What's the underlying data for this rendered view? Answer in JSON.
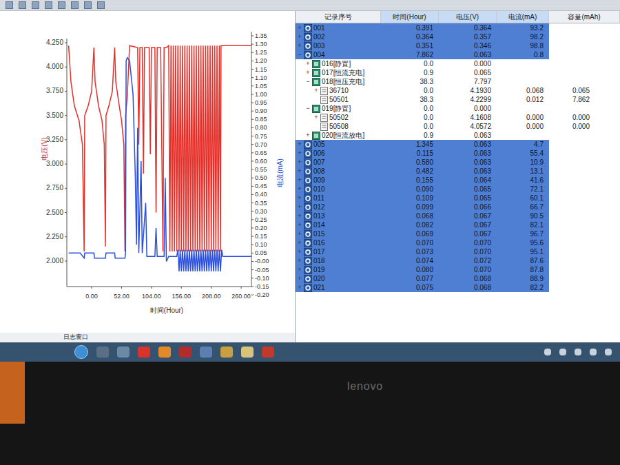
{
  "chart": {
    "y_left_label": "电压(V)",
    "y_right_label": "电流(mA)",
    "x_label": "时间(Hour)",
    "y_left_ticks": [
      "4.250",
      "4.000",
      "3.750",
      "3.500",
      "3.250",
      "3.000",
      "2.750",
      "2.500",
      "2.250",
      "2.000"
    ],
    "y_right_ticks": [
      "1.35",
      "1.30",
      "1.25",
      "1.20",
      "1.15",
      "1.10",
      "1.05",
      "1.00",
      "0.95",
      "0.90",
      "0.85",
      "0.80",
      "0.75",
      "0.70",
      "0.65",
      "0.60",
      "0.55",
      "0.50",
      "0.45",
      "0.40",
      "0.35",
      "0.30",
      "0.25",
      "0.20",
      "0.15",
      "0.10",
      "0.05",
      "-0.00",
      "-0.05",
      "-0.10",
      "-0.15",
      "-0.20"
    ],
    "x_ticks": [
      "0.00",
      "52.00",
      "104.00",
      "156.00",
      "208.00",
      "260.00"
    ],
    "series": [
      {
        "axis": "left",
        "color": "#e8302a",
        "points": [
          [
            -40,
            4.22
          ],
          [
            -36,
            3.85
          ],
          [
            -30,
            3.6
          ],
          [
            -22,
            3.45
          ],
          [
            -16,
            3.2
          ],
          [
            -13,
            2.1
          ],
          [
            -12,
            3.5
          ],
          [
            -6,
            3.6
          ],
          [
            0,
            3.75
          ],
          [
            4,
            4.2
          ],
          [
            6,
            3.85
          ],
          [
            12,
            3.6
          ],
          [
            18,
            3.45
          ],
          [
            22,
            3.2
          ],
          [
            24,
            2.15
          ],
          [
            25,
            3.5
          ],
          [
            30,
            3.6
          ],
          [
            36,
            3.75
          ],
          [
            40,
            4.2
          ],
          [
            42,
            3.85
          ],
          [
            48,
            3.6
          ],
          [
            52,
            3.45
          ],
          [
            56,
            3.2
          ],
          [
            58,
            2.1
          ],
          [
            59,
            3.5
          ],
          [
            62,
            3.7
          ],
          [
            66,
            4.22
          ],
          [
            80,
            4.2
          ],
          [
            82,
            3.2
          ],
          [
            84,
            4.2
          ],
          [
            88,
            4.2
          ],
          [
            90,
            2.9
          ],
          [
            92,
            4.2
          ],
          [
            100,
            4.2
          ],
          [
            102,
            3.1
          ],
          [
            104,
            4.2
          ],
          [
            110,
            4.2
          ],
          [
            112,
            2.5
          ],
          [
            114,
            4.2
          ],
          [
            120,
            4.2
          ],
          [
            124,
            2.1
          ],
          [
            126,
            4.2
          ],
          [
            130,
            4.2
          ],
          [
            134,
            4.22
          ],
          [
            136,
            2.1
          ],
          [
            138,
            4.22
          ],
          [
            140,
            2.1
          ],
          [
            142,
            4.22
          ],
          [
            144,
            2.1
          ],
          [
            146,
            4.22
          ],
          [
            148,
            2.1
          ],
          [
            150,
            4.22
          ],
          [
            152,
            2.1
          ],
          [
            154,
            4.22
          ],
          [
            156,
            2.1
          ],
          [
            158,
            4.22
          ],
          [
            160,
            2.1
          ],
          [
            162,
            4.22
          ],
          [
            164,
            2.1
          ],
          [
            166,
            4.22
          ],
          [
            168,
            2.1
          ],
          [
            170,
            4.22
          ],
          [
            172,
            2.1
          ],
          [
            174,
            4.22
          ],
          [
            176,
            2.1
          ],
          [
            178,
            4.22
          ],
          [
            180,
            2.1
          ],
          [
            182,
            4.22
          ],
          [
            184,
            2.1
          ],
          [
            186,
            4.22
          ],
          [
            188,
            2.1
          ],
          [
            190,
            4.22
          ],
          [
            192,
            2.1
          ],
          [
            194,
            4.22
          ],
          [
            196,
            2.1
          ],
          [
            198,
            4.22
          ],
          [
            200,
            2.1
          ],
          [
            202,
            4.22
          ],
          [
            204,
            2.1
          ],
          [
            206,
            4.22
          ],
          [
            208,
            2.1
          ],
          [
            210,
            4.22
          ],
          [
            212,
            2.1
          ],
          [
            214,
            4.22
          ],
          [
            216,
            2.1
          ],
          [
            218,
            4.22
          ],
          [
            220,
            2.1
          ],
          [
            222,
            4.22
          ],
          [
            224,
            2.1
          ],
          [
            225,
            4.22
          ],
          [
            278,
            4.22
          ]
        ]
      },
      {
        "axis": "right",
        "color": "#2a4fe0",
        "points": [
          [
            -40,
            0.05
          ],
          [
            -20,
            0.05
          ],
          [
            -13,
            0.02
          ],
          [
            -12,
            0.05
          ],
          [
            4,
            0.05
          ],
          [
            5,
            0.02
          ],
          [
            24,
            0.02
          ],
          [
            25,
            0.05
          ],
          [
            40,
            0.05
          ],
          [
            41,
            0.02
          ],
          [
            58,
            0.02
          ],
          [
            59,
            0.05
          ],
          [
            60,
            1.2
          ],
          [
            62,
            1.22
          ],
          [
            66,
            1.2
          ],
          [
            72,
            1.0
          ],
          [
            76,
            0.5
          ],
          [
            78,
            0.1
          ],
          [
            80,
            0.8
          ],
          [
            82,
            0.05
          ],
          [
            86,
            0.6
          ],
          [
            88,
            0.05
          ],
          [
            94,
            0.35
          ],
          [
            96,
            0.03
          ],
          [
            110,
            0.03
          ],
          [
            112,
            0.2
          ],
          [
            114,
            0.03
          ],
          [
            126,
            0.03
          ],
          [
            128,
            0.5
          ],
          [
            130,
            0.0
          ],
          [
            134,
            0.03
          ],
          [
            148,
            0.03
          ],
          [
            150,
            0.07
          ],
          [
            152,
            -0.06
          ],
          [
            154,
            0.07
          ],
          [
            156,
            -0.06
          ],
          [
            158,
            0.07
          ],
          [
            160,
            -0.06
          ],
          [
            162,
            0.07
          ],
          [
            164,
            -0.06
          ],
          [
            166,
            0.07
          ],
          [
            168,
            -0.06
          ],
          [
            170,
            0.07
          ],
          [
            172,
            -0.06
          ],
          [
            174,
            0.07
          ],
          [
            176,
            -0.06
          ],
          [
            178,
            0.07
          ],
          [
            180,
            -0.06
          ],
          [
            182,
            0.07
          ],
          [
            184,
            -0.06
          ],
          [
            186,
            0.07
          ],
          [
            188,
            -0.06
          ],
          [
            190,
            0.07
          ],
          [
            192,
            -0.06
          ],
          [
            194,
            0.07
          ],
          [
            196,
            -0.06
          ],
          [
            198,
            0.07
          ],
          [
            200,
            -0.06
          ],
          [
            202,
            0.07
          ],
          [
            204,
            -0.06
          ],
          [
            206,
            0.07
          ],
          [
            208,
            -0.06
          ],
          [
            210,
            0.07
          ],
          [
            212,
            -0.06
          ],
          [
            214,
            0.07
          ],
          [
            216,
            -0.06
          ],
          [
            218,
            0.07
          ],
          [
            220,
            -0.06
          ],
          [
            222,
            0.07
          ],
          [
            224,
            -0.06
          ],
          [
            226,
            0.07
          ],
          [
            228,
            0.03
          ],
          [
            278,
            0.03
          ]
        ]
      }
    ]
  },
  "log_window": {
    "label": "日志窗口"
  },
  "table": {
    "columns": [
      "记录序号",
      "时间(Hour)",
      "电压(V)",
      "电流(mA)",
      "容量(mAh)"
    ],
    "rows": [
      {
        "kind": "cycle",
        "toggle": "+",
        "label": "001",
        "time": "0.391",
        "voltage": "0.364",
        "current": "93.2",
        "capacity": "",
        "selected": true
      },
      {
        "kind": "cycle",
        "toggle": "+",
        "label": "002",
        "time": "0.364",
        "voltage": "0.357",
        "current": "98.2",
        "capacity": "",
        "selected": true
      },
      {
        "kind": "cycle",
        "toggle": "+",
        "label": "003",
        "time": "0.351",
        "voltage": "0.346",
        "current": "98.8",
        "capacity": "",
        "selected": true
      },
      {
        "kind": "cycle",
        "toggle": "−",
        "label": "004",
        "time": "7.862",
        "voltage": "0.063",
        "current": "0.8",
        "capacity": "",
        "selected": true
      },
      {
        "kind": "step",
        "toggle": "+",
        "label": "016[静置]",
        "time": "0.0",
        "voltage": "0.000",
        "current": "",
        "capacity": "",
        "selected": false
      },
      {
        "kind": "step",
        "toggle": "+",
        "label": "017[恒流充电]",
        "time": "0.9",
        "voltage": "0.065",
        "current": "",
        "capacity": "",
        "selected": false
      },
      {
        "kind": "step",
        "toggle": "−",
        "label": "018[恒压充电]",
        "time": "38.3",
        "voltage": "7.797",
        "current": "",
        "capacity": "",
        "selected": false
      },
      {
        "kind": "record",
        "toggle": "+",
        "label": "36710",
        "time": "0.0",
        "voltage": "4.1930",
        "current": "0.068",
        "capacity": "0.065",
        "selected": false
      },
      {
        "kind": "record",
        "toggle": "",
        "label": "50501",
        "time": "38.3",
        "voltage": "4.2299",
        "current": "0.012",
        "capacity": "7.862",
        "selected": false
      },
      {
        "kind": "step",
        "toggle": "−",
        "label": "019[静置]",
        "time": "0.0",
        "voltage": "0.000",
        "current": "",
        "capacity": "",
        "selected": false
      },
      {
        "kind": "record",
        "toggle": "+",
        "label": "50502",
        "time": "0.0",
        "voltage": "4.1608",
        "current": "0.000",
        "capacity": "0.000",
        "selected": false
      },
      {
        "kind": "record",
        "toggle": "",
        "label": "50508",
        "time": "0.0",
        "voltage": "4.0572",
        "current": "0.000",
        "capacity": "0.000",
        "selected": false
      },
      {
        "kind": "step",
        "toggle": "+",
        "label": "020[恒流放电]",
        "time": "0.9",
        "voltage": "0.063",
        "current": "",
        "capacity": "",
        "selected": false
      },
      {
        "kind": "cycle",
        "toggle": "+",
        "label": "005",
        "time": "1.345",
        "voltage": "0.063",
        "current": "4.7",
        "capacity": "",
        "selected": true
      },
      {
        "kind": "cycle",
        "toggle": "+",
        "label": "006",
        "time": "0.115",
        "voltage": "0.063",
        "current": "55.4",
        "capacity": "",
        "selected": true
      },
      {
        "kind": "cycle",
        "toggle": "+",
        "label": "007",
        "time": "0.580",
        "voltage": "0.063",
        "current": "10.9",
        "capacity": "",
        "selected": true
      },
      {
        "kind": "cycle",
        "toggle": "+",
        "label": "008",
        "time": "0.482",
        "voltage": "0.063",
        "current": "13.1",
        "capacity": "",
        "selected": true
      },
      {
        "kind": "cycle",
        "toggle": "+",
        "label": "009",
        "time": "0.155",
        "voltage": "0.064",
        "current": "41.6",
        "capacity": "",
        "selected": true
      },
      {
        "kind": "cycle",
        "toggle": "+",
        "label": "010",
        "time": "0.090",
        "voltage": "0.065",
        "current": "72.1",
        "capacity": "",
        "selected": true
      },
      {
        "kind": "cycle",
        "toggle": "+",
        "label": "011",
        "time": "0.109",
        "voltage": "0.065",
        "current": "60.1",
        "capacity": "",
        "selected": true
      },
      {
        "kind": "cycle",
        "toggle": "+",
        "label": "012",
        "time": "0.099",
        "voltage": "0.066",
        "current": "66.7",
        "capacity": "",
        "selected": true
      },
      {
        "kind": "cycle",
        "toggle": "+",
        "label": "013",
        "time": "0.068",
        "voltage": "0.067",
        "current": "90.5",
        "capacity": "",
        "selected": true
      },
      {
        "kind": "cycle",
        "toggle": "+",
        "label": "014",
        "time": "0.082",
        "voltage": "0.067",
        "current": "82.1",
        "capacity": "",
        "selected": true
      },
      {
        "kind": "cycle",
        "toggle": "+",
        "label": "015",
        "time": "0.069",
        "voltage": "0.067",
        "current": "96.7",
        "capacity": "",
        "selected": true
      },
      {
        "kind": "cycle",
        "toggle": "+",
        "label": "016",
        "time": "0.070",
        "voltage": "0.070",
        "current": "95.6",
        "capacity": "",
        "selected": true
      },
      {
        "kind": "cycle",
        "toggle": "+",
        "label": "017",
        "time": "0.073",
        "voltage": "0.070",
        "current": "95.1",
        "capacity": "",
        "selected": true
      },
      {
        "kind": "cycle",
        "toggle": "+",
        "label": "018",
        "time": "0.074",
        "voltage": "0.072",
        "current": "87.6",
        "capacity": "",
        "selected": true
      },
      {
        "kind": "cycle",
        "toggle": "+",
        "label": "019",
        "time": "0.080",
        "voltage": "0.070",
        "current": "87.8",
        "capacity": "",
        "selected": true
      },
      {
        "kind": "cycle",
        "toggle": "+",
        "label": "020",
        "time": "0.077",
        "voltage": "0.068",
        "current": "88.9",
        "capacity": "",
        "selected": true
      },
      {
        "kind": "cycle",
        "toggle": "+",
        "label": "021",
        "time": "0.075",
        "voltage": "0.068",
        "current": "82.2",
        "capacity": "",
        "selected": true
      }
    ]
  },
  "bezel": {
    "brand": "lenovo"
  }
}
